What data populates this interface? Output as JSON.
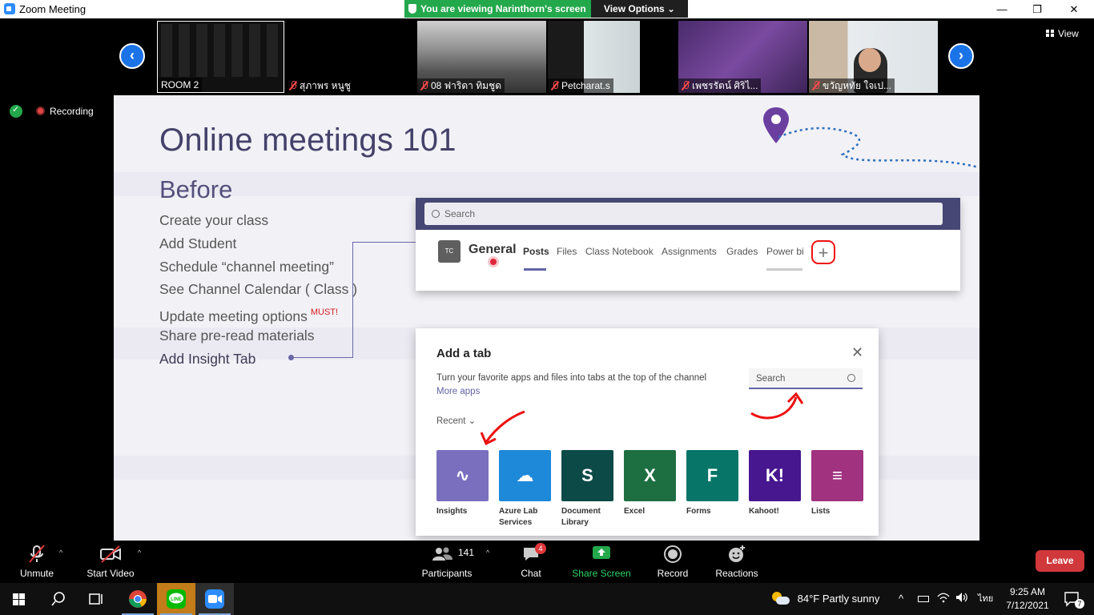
{
  "window": {
    "title": "Zoom Meeting",
    "minimize": "—",
    "maximize": "❐",
    "close": "✕"
  },
  "share_banner": {
    "viewing_text": "You are viewing Narinthorn's screen",
    "view_options": "View Options ⌄"
  },
  "strip": {
    "prev": "‹",
    "next": "›",
    "view_label": "View",
    "participants": [
      {
        "name": "ROOM 2",
        "muted": false
      },
      {
        "name": "สุภาพร  หนูชู",
        "muted": true
      },
      {
        "name": "08 ฟาริดา ทิมชูด",
        "muted": true
      },
      {
        "name": "Petcharat.s",
        "muted": true
      },
      {
        "name": "เพชรรัตน์ ศิริไ...",
        "muted": true
      },
      {
        "name": "ขวัญหทัย  ใจเป...",
        "muted": true
      }
    ]
  },
  "status": {
    "recording": "Recording"
  },
  "slide": {
    "title": "Online meetings 101",
    "section": "Before",
    "steps": [
      "Create your class",
      "Add Student",
      "Schedule “channel meeting”",
      "See Channel Calendar ( Class )",
      "Update meeting options",
      "Share pre-read materials",
      "Add Insight Tab"
    ],
    "must": "MUST!",
    "teams": {
      "search_placeholder": "Search",
      "team_initials": "TC",
      "channel": "General",
      "tabs": [
        "Posts",
        "Files",
        "Class Notebook",
        "Assignments",
        "Grades",
        "Power bi"
      ],
      "add_tab": "+"
    },
    "dialog": {
      "title": "Add a tab",
      "close": "✕",
      "description": "Turn your favorite apps and files into tabs at the top of the channel",
      "more_apps": "More apps",
      "search_placeholder": "Search",
      "recent": "Recent ⌄",
      "apps": [
        {
          "label": "Insights",
          "color": "#7a6fbf",
          "glyph": "∿"
        },
        {
          "label": "Azure Lab Services",
          "color": "#1e88d9",
          "glyph": "☁"
        },
        {
          "label": "Document Library",
          "color": "#0c4a47",
          "glyph": "S"
        },
        {
          "label": "Excel",
          "color": "#1d6f42",
          "glyph": "X"
        },
        {
          "label": "Forms",
          "color": "#077568",
          "glyph": "F"
        },
        {
          "label": "Kahoot!",
          "color": "#46178f",
          "glyph": "K!"
        },
        {
          "label": "Lists",
          "color": "#a0327f",
          "glyph": "≡"
        }
      ]
    }
  },
  "toolbar": {
    "unmute": "Unmute",
    "start_video": "Start Video",
    "participants_count": "141",
    "participants": "Participants",
    "chat": "Chat",
    "chat_badge": "4",
    "share_screen": "Share Screen",
    "record": "Record",
    "reactions": "Reactions",
    "leave": "Leave",
    "caret": "^"
  },
  "taskbar": {
    "weather": "84°F  Partly sunny",
    "language": "ไทย",
    "time": "9:25 AM",
    "date": "7/12/2021",
    "notifications": "7"
  },
  "colors": {
    "zoom_blue": "#2d8cff",
    "share_green": "#23a84c",
    "leave_red": "#d0383b",
    "teams_purple": "#464775"
  }
}
